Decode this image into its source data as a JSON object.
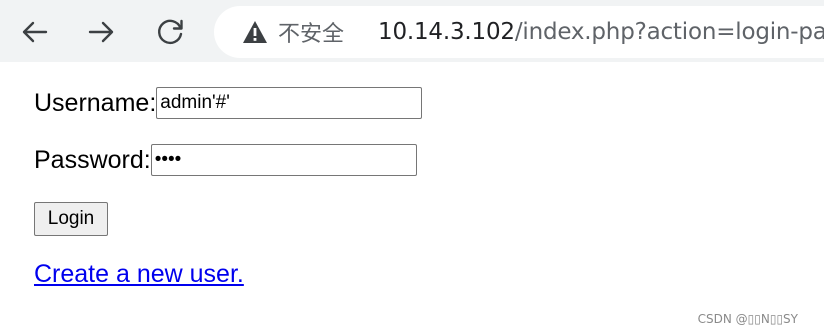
{
  "browser": {
    "nav": {
      "back_icon": "arrow-left-icon",
      "forward_icon": "arrow-right-icon",
      "reload_icon": "reload-icon"
    },
    "omnibox": {
      "security_icon": "warning-triangle-icon",
      "security_label": "不安全",
      "url_host": "10.14.3.102",
      "url_path": "/index.php?action=login-page"
    }
  },
  "form": {
    "username_label": "Username:",
    "username_value": "admin'#'",
    "password_label": "Password:",
    "password_value": "••••",
    "login_label": "Login"
  },
  "links": {
    "create_user": "Create a new user."
  },
  "watermark": "CSDN @▯▯N▯▯SY",
  "colors": {
    "toolbar_bg": "#f1f3f4",
    "link": "#0000ee",
    "url_host": "#202124",
    "url_path": "#5f6368"
  }
}
